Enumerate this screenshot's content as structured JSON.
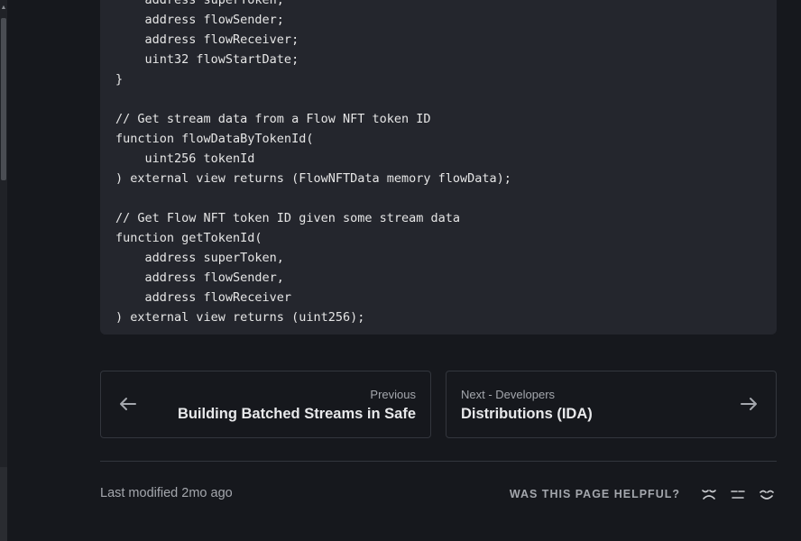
{
  "code_lines": [
    "    address superToken;",
    "    address flowSender;",
    "    address flowReceiver;",
    "    uint32 flowStartDate;",
    "}",
    "",
    "// Get stream data from a Flow NFT token ID",
    "function flowDataByTokenId(",
    "    uint256 tokenId",
    ") external view returns (FlowNFTData memory flowData);",
    "",
    "// Get Flow NFT token ID given some stream data",
    "function getTokenId(",
    "    address superToken,",
    "    address flowSender,",
    "    address flowReceiver",
    ") external view returns (uint256);"
  ],
  "pagination": {
    "previous": {
      "caption": "Previous",
      "title": "Building Batched Streams in Safe"
    },
    "next": {
      "caption": "Next - Developers",
      "title": "Distributions (IDA)"
    }
  },
  "footer": {
    "last_modified": "Last modified 2mo ago",
    "feedback_label": "WAS THIS PAGE HELPFUL?",
    "feedback_icons": [
      "sad-face-icon",
      "neutral-face-icon",
      "happy-face-icon"
    ]
  },
  "colors": {
    "background": "#16181d",
    "code_background": "#24262d",
    "text_primary": "#e8e9eb",
    "text_secondary": "#a4a7ad"
  }
}
